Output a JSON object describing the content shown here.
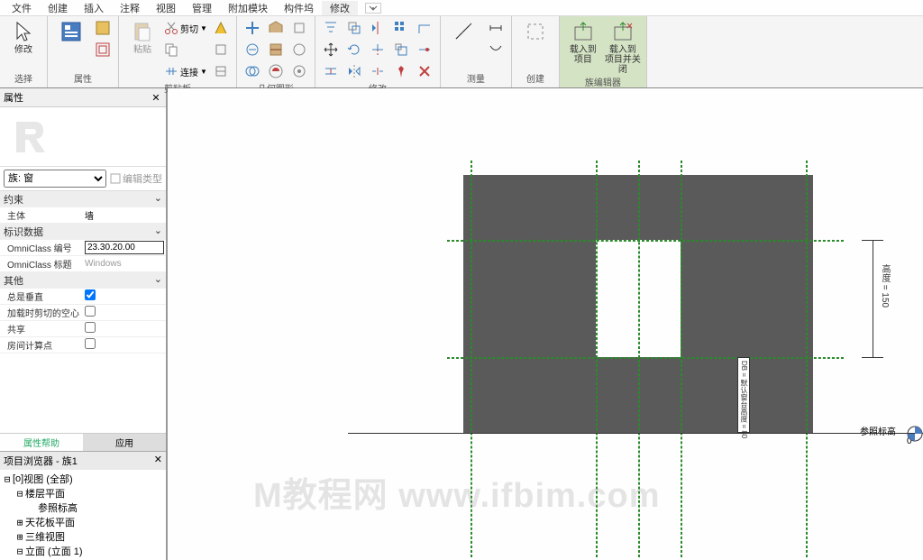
{
  "menu": {
    "items": [
      "文件",
      "创建",
      "插入",
      "注释",
      "视图",
      "管理",
      "附加模块",
      "构件坞",
      "修改"
    ],
    "active": 8
  },
  "ribbon": {
    "groups": {
      "select": {
        "label": "选择",
        "modify": "修改"
      },
      "properties": {
        "label": "属性"
      },
      "clipboard": {
        "label": "剪贴板",
        "paste": "粘贴",
        "cut": "剪切",
        "connect": "连接"
      },
      "geometry": {
        "label": "几何图形"
      },
      "modify_big": {
        "label": "修改"
      },
      "measure": {
        "label": "测量"
      },
      "create": {
        "label": "创建"
      },
      "family_editor": {
        "label": "族编辑器",
        "load_project": "载入到\n项目",
        "load_close": "载入到\n项目并关闭"
      }
    }
  },
  "properties": {
    "title": "属性",
    "family": "族: 窗",
    "edit_type": "编辑类型",
    "sections": {
      "constraints": "约束",
      "host_k": "主体",
      "host_v": "墙",
      "identity": "标识数据",
      "omni_num_k": "OmniClass 编号",
      "omni_num_v": "23.30.20.00",
      "omni_title_k": "OmniClass 标题",
      "omni_title_v": "Windows",
      "other": "其他",
      "always_vert_k": "总是垂直",
      "cut_void_k": "加载时剪切的空心",
      "shared_k": "共享",
      "room_calc_k": "房间计算点"
    },
    "footer": {
      "help": "属性帮助",
      "apply": "应用"
    }
  },
  "browser": {
    "title": "项目浏览器 - 族1",
    "nodes": {
      "views": "视图 (全部)",
      "floor_plans": "楼层平面",
      "ref_level": "参照标高",
      "ceiling": "天花板平面",
      "three_d": "三维视图",
      "elev": "立面 (立面 1)"
    }
  },
  "canvas": {
    "dim_height": "高度 = 150",
    "sill_label": "DB = 默认窗台高度 = 80",
    "ref_level": "参照标高",
    "ref_zero": "0"
  },
  "watermark": "M教程网 www.ifbim.com"
}
